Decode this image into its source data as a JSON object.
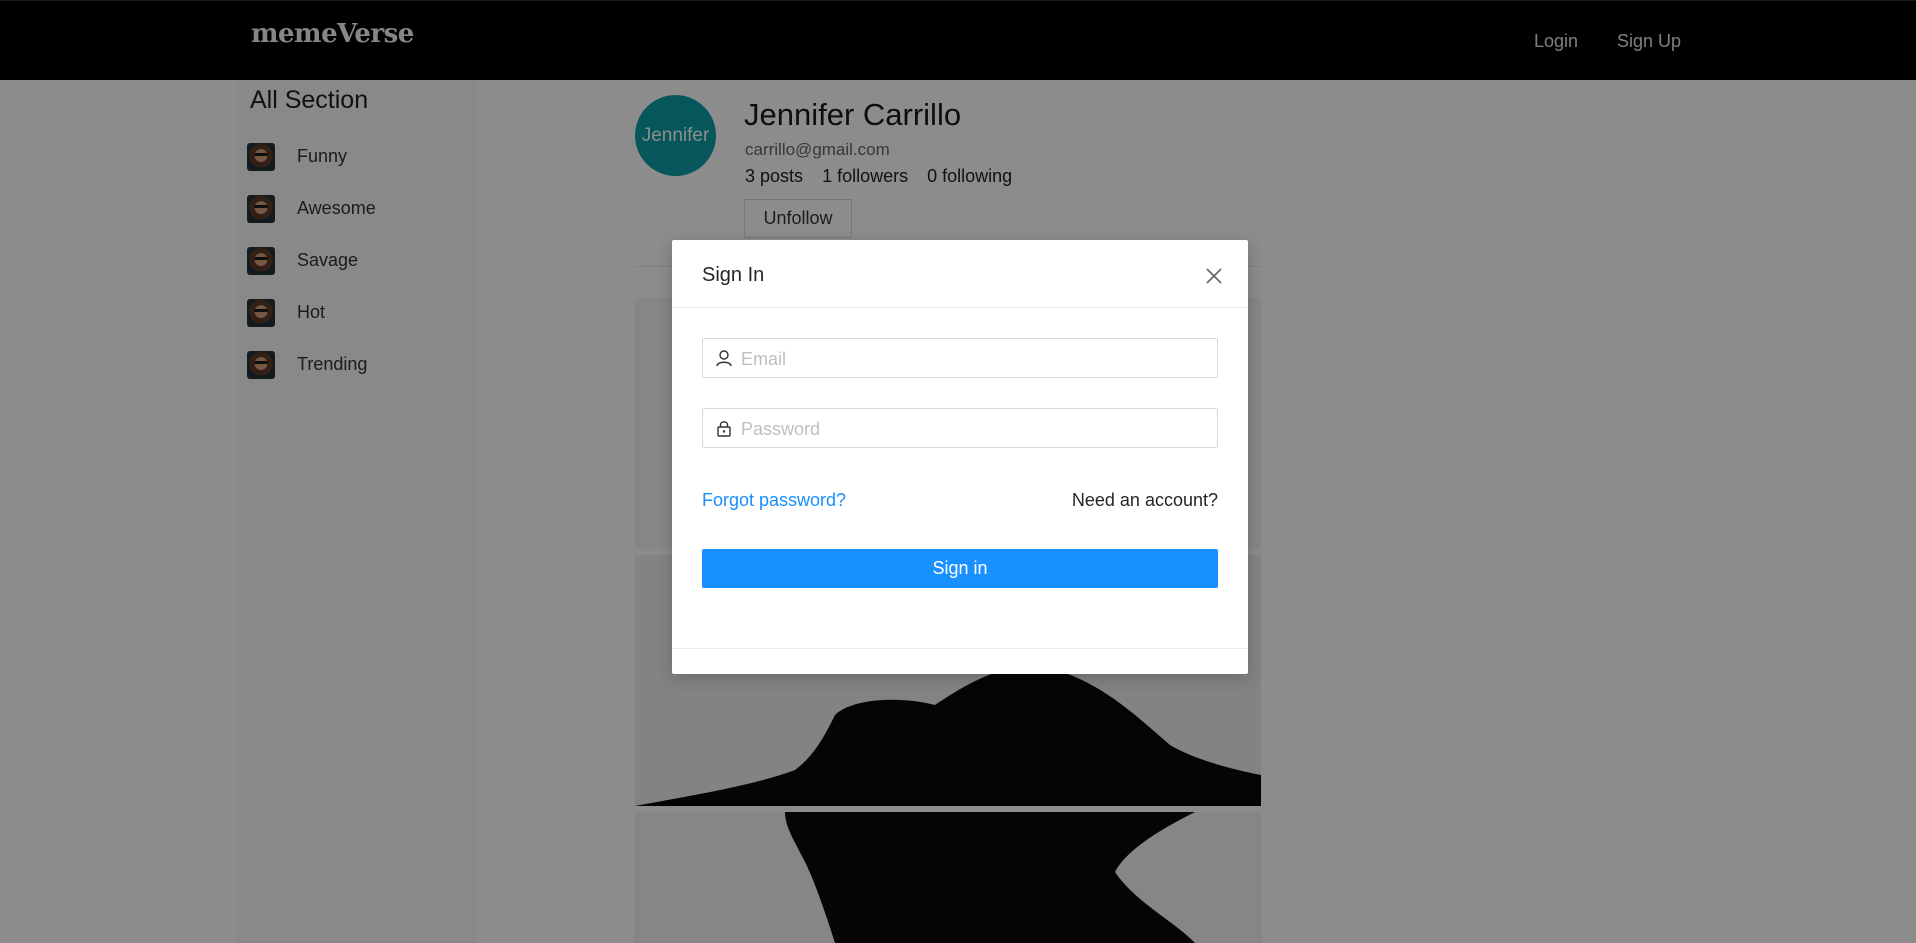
{
  "header": {
    "logo": "memeVerse",
    "nav": [
      {
        "label": "Login"
      },
      {
        "label": "Sign Up"
      }
    ]
  },
  "sidebar": {
    "title": "All Section",
    "items": [
      {
        "label": "Funny"
      },
      {
        "label": "Awesome"
      },
      {
        "label": "Savage"
      },
      {
        "label": "Hot"
      },
      {
        "label": "Trending"
      }
    ]
  },
  "profile": {
    "avatar_text": "Jennifer",
    "name": "Jennifer Carrillo",
    "email": "carrillo@gmail.com",
    "posts": "3 posts",
    "followers": "1 followers",
    "following": "0 following",
    "unfollow_label": "Unfollow"
  },
  "modal": {
    "title": "Sign In",
    "email_placeholder": "Email",
    "password_placeholder": "Password",
    "forgot_label": "Forgot password?",
    "need_account_label": "Need an account?",
    "signin_label": "Sign in"
  },
  "colors": {
    "accent": "#1890ff",
    "avatar_bg": "#0c9ea8",
    "header_bg": "#000000"
  }
}
